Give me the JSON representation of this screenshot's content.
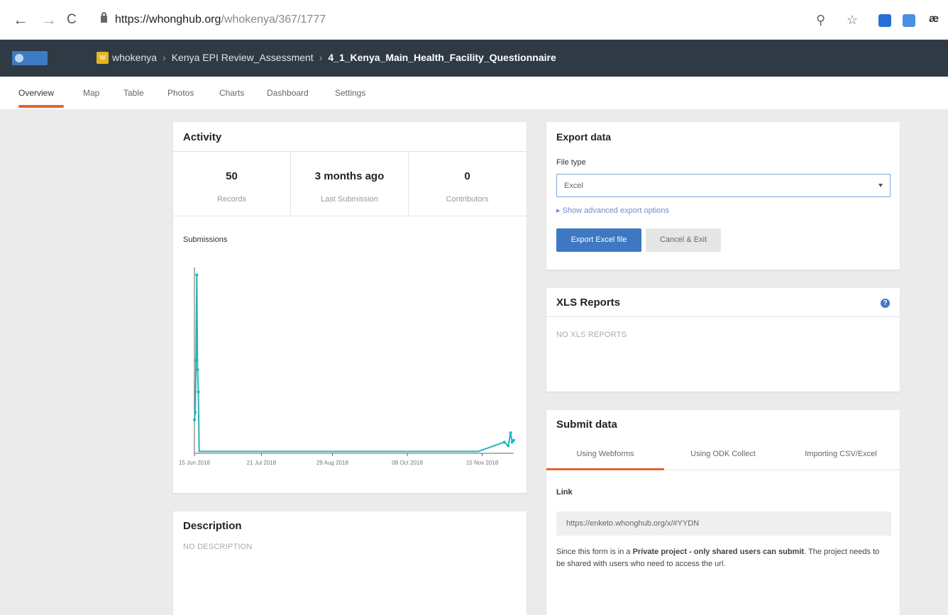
{
  "browser": {
    "url_host": "https://whonghub.org",
    "url_path": "/whokenya/367/1777",
    "back_glyph": "←",
    "forward_glyph": "→",
    "reload_glyph": "C",
    "zoom_glyph": "⚲",
    "star_glyph": "☆",
    "ext_text": "æ"
  },
  "header": {
    "project_icon_text": "W",
    "crumbs": [
      "whokenya",
      "Kenya EPI Review_Assessment"
    ],
    "current": "4_1_Kenya_Main_Health_Facility_Questionnaire",
    "separator": "›"
  },
  "tabs": [
    "Overview",
    "Map",
    "Table",
    "Photos",
    "Charts",
    "Dashboard",
    "Settings"
  ],
  "activity": {
    "title": "Activity",
    "stats": [
      {
        "value": "50",
        "label": "Records"
      },
      {
        "value": "3 months ago",
        "label": "Last Submission"
      },
      {
        "value": "0",
        "label": "Contributors"
      }
    ],
    "submissions_label": "Submissions",
    "chart_data": {
      "type": "line",
      "x_ticks": [
        "15 Jun 2018",
        "21 Jul 2018",
        "29 Aug 2018",
        "08 Oct 2018",
        "15 Nov 2018"
      ],
      "x": [
        0,
        1,
        2,
        3,
        4,
        5,
        6,
        8,
        40,
        80,
        120,
        160,
        200,
        240,
        280,
        320,
        360,
        393,
        398,
        401,
        403,
        405
      ],
      "values": [
        0.18,
        0.22,
        0.5,
        0.96,
        0.45,
        0.33,
        0.01,
        0.01,
        0.01,
        0.01,
        0.01,
        0.01,
        0.01,
        0.01,
        0.01,
        0.01,
        0.01,
        0.06,
        0.04,
        0.11,
        0.06,
        0.07
      ],
      "grid": false
    }
  },
  "description": {
    "title": "Description",
    "empty": "NO DESCRIPTION"
  },
  "export": {
    "title": "Export data",
    "file_type_label": "File type",
    "file_type_value": "Excel",
    "advanced_link": "▸  Show advanced export options",
    "primary_button": "Export Excel file",
    "cancel_button": "Cancel & Exit"
  },
  "xls": {
    "title": "XLS Reports",
    "help": "?",
    "empty": "NO XLS REPORTS"
  },
  "submit": {
    "title": "Submit data",
    "tabs": [
      "Using Webforms",
      "Using ODK Collect",
      "Importing CSV/Excel"
    ],
    "link_label": "Link",
    "link_value": "https://enketo.whonghub.org/x/#YYDN",
    "text_before": "Since this form is in a ",
    "text_bold": "Private project - only shared users can submit",
    "text_after": ". The project needs to be shared with users who need to access the url."
  },
  "colors": {
    "accent": "#e8622c",
    "primary": "#3e78c2",
    "header": "#2f3a45",
    "chart_line": "#26b3b8"
  }
}
